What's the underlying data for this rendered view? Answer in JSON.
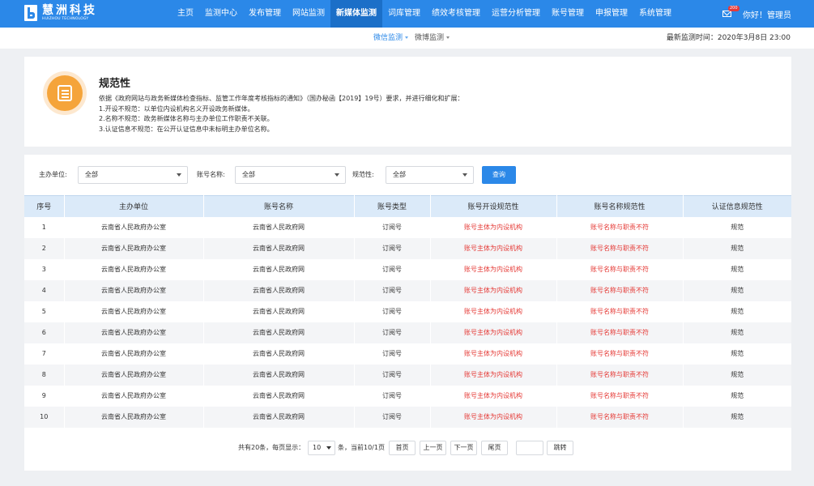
{
  "brand": {
    "name": "慧洲科技",
    "sub": "HUIZHOU TECHNOLOGY"
  },
  "nav": {
    "items": [
      "主页",
      "监测中心",
      "发布管理",
      "网站监测",
      "新媒体监测",
      "词库管理",
      "绩效考核管理",
      "运营分析管理",
      "账号管理",
      "申报管理",
      "系统管理"
    ],
    "active_index": 4
  },
  "user": {
    "mail_badge": "200",
    "greeting": "你好！管理员"
  },
  "subnav": {
    "tabs": [
      "微信监测",
      "微博监测"
    ],
    "active_index": 0,
    "monitor_time": "最新监测时间：2020年3月8日 23:00"
  },
  "info": {
    "title": "规范性",
    "lines": [
      "依据《政府网站与政务新媒体检查指标、监管工作年度考核指标的通知》（国办秘函【2019】19号）要求，并进行细化和扩展：",
      "1.开设不规范：以单位内设机构名义开设政务新媒体。",
      "2.名称不规范：政务新媒体名称与主办单位工作职责不关联。",
      "3.认证信息不规范：在公开认证信息中未标明主办单位名称。"
    ]
  },
  "filters": {
    "org_label": "主办单位:",
    "org_value": "全部",
    "account_label": "账号名称:",
    "account_value": "全部",
    "norm_label": "规范性:",
    "norm_value": "全部",
    "query_label": "查询"
  },
  "table": {
    "headers": [
      "序号",
      "主办单位",
      "账号名称",
      "账号类型",
      "账号开设规范性",
      "账号名称规范性",
      "认证信息规范性"
    ],
    "rows": [
      [
        "1",
        "云南省人民政府办公室",
        "云南省人民政府网",
        "订阅号",
        "账号主体为内设机构",
        "账号名称与职责不符",
        "规范"
      ],
      [
        "2",
        "云南省人民政府办公室",
        "云南省人民政府网",
        "订阅号",
        "账号主体为内设机构",
        "账号名称与职责不符",
        "规范"
      ],
      [
        "3",
        "云南省人民政府办公室",
        "云南省人民政府网",
        "订阅号",
        "账号主体为内设机构",
        "账号名称与职责不符",
        "规范"
      ],
      [
        "4",
        "云南省人民政府办公室",
        "云南省人民政府网",
        "订阅号",
        "账号主体为内设机构",
        "账号名称与职责不符",
        "规范"
      ],
      [
        "5",
        "云南省人民政府办公室",
        "云南省人民政府网",
        "订阅号",
        "账号主体为内设机构",
        "账号名称与职责不符",
        "规范"
      ],
      [
        "6",
        "云南省人民政府办公室",
        "云南省人民政府网",
        "订阅号",
        "账号主体为内设机构",
        "账号名称与职责不符",
        "规范"
      ],
      [
        "7",
        "云南省人民政府办公室",
        "云南省人民政府网",
        "订阅号",
        "账号主体为内设机构",
        "账号名称与职责不符",
        "规范"
      ],
      [
        "8",
        "云南省人民政府办公室",
        "云南省人民政府网",
        "订阅号",
        "账号主体为内设机构",
        "账号名称与职责不符",
        "规范"
      ],
      [
        "9",
        "云南省人民政府办公室",
        "云南省人民政府网",
        "订阅号",
        "账号主体为内设机构",
        "账号名称与职责不符",
        "规范"
      ],
      [
        "10",
        "云南省人民政府办公室",
        "云南省人民政府网",
        "订阅号",
        "账号主体为内设机构",
        "账号名称与职责不符",
        "规范"
      ]
    ]
  },
  "pager": {
    "total_text": "共有20条，每页显示：",
    "page_size": "10",
    "status_text": "条，当前10/1页",
    "first": "首页",
    "prev": "上一页",
    "next": "下一页",
    "last": "尾页",
    "jump": "跳转"
  },
  "colors": {
    "brand_blue": "#2b88e8",
    "nav_active": "#1b6fc8",
    "warning_red": "#e53935",
    "icon_orange": "#f5a43a"
  }
}
